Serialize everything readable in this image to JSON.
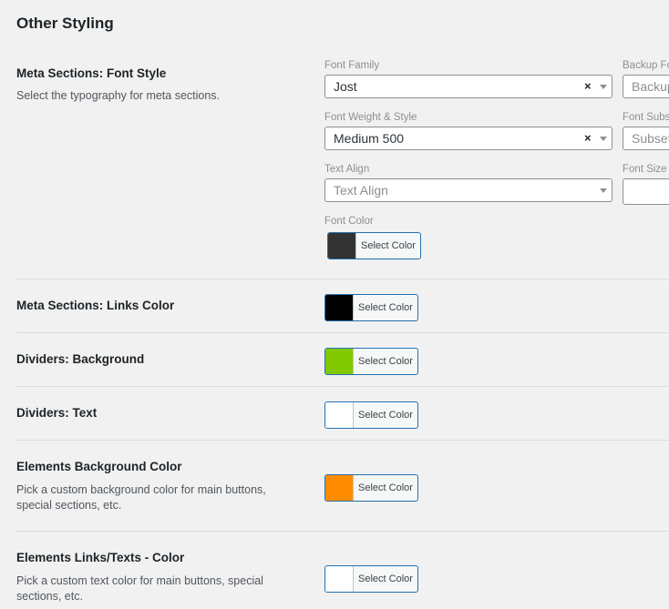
{
  "section_title": "Other Styling",
  "meta_font_style": {
    "title": "Meta Sections: Font Style",
    "desc": "Select the typography for meta sections.",
    "font_family": {
      "label": "Font Family",
      "value": "Jost",
      "clear": "×"
    },
    "backup_font": {
      "label": "Backup Fo",
      "placeholder": "Backup"
    },
    "font_weight": {
      "label": "Font Weight & Style",
      "value": "Medium 500",
      "clear": "×"
    },
    "font_subset": {
      "label": "Font Subs",
      "placeholder": "Subset"
    },
    "text_align": {
      "label": "Text Align",
      "placeholder": "Text Align"
    },
    "font_size": {
      "label": "Font Size"
    },
    "font_color": {
      "label": "Font Color",
      "button": "Select Color",
      "color": "#333333"
    }
  },
  "rows": [
    {
      "title": "Meta Sections: Links Color",
      "desc": "",
      "button": "Select Color",
      "color": "#000000"
    },
    {
      "title": "Dividers: Background",
      "desc": "",
      "button": "Select Color",
      "color": "#81c800"
    },
    {
      "title": "Dividers: Text",
      "desc": "",
      "button": "Select Color",
      "color": "#ffffff"
    },
    {
      "title": "Elements Background Color",
      "desc": "Pick a custom background color for main buttons, special sections, etc.",
      "button": "Select Color",
      "color": "#ff8c00"
    },
    {
      "title": "Elements Links/Texts - Color",
      "desc": "Pick a custom text color for main buttons, special sections, etc.",
      "button": "Select Color",
      "color": "#ffffff"
    }
  ]
}
